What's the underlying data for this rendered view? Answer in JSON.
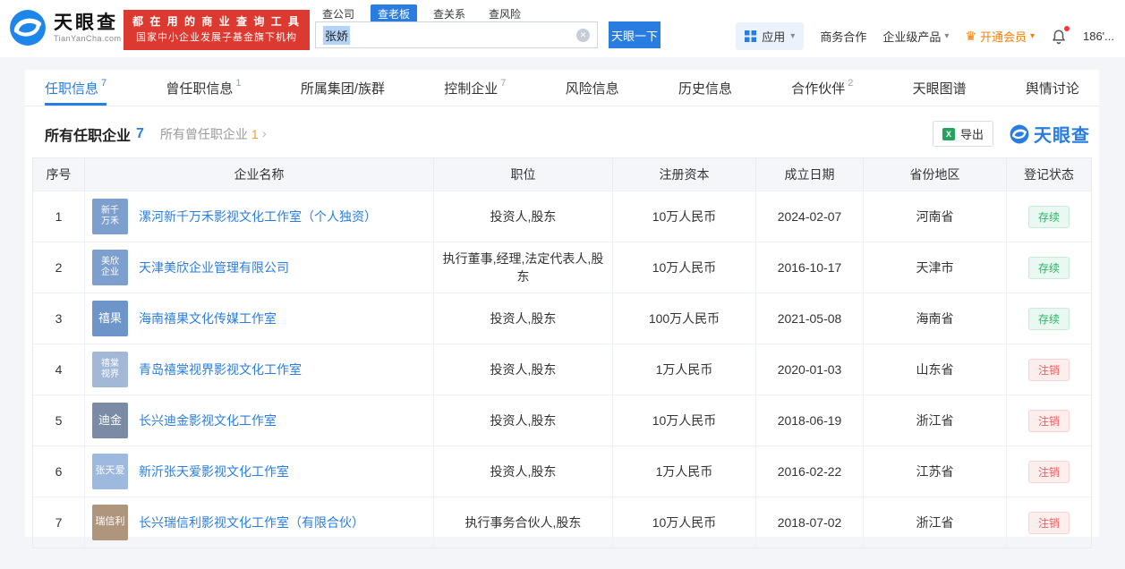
{
  "colors": {
    "accent": "#2a7de0",
    "vip_orange": "#ff7d00",
    "promo_red": "#dc3a31",
    "status_active_green": "#2bb36b",
    "status_cancelled_red": "#f25b5b"
  },
  "icons": {
    "chevron_down": "▾",
    "chevron_right": "›",
    "close_circle": "✕",
    "crown": "♛",
    "excel_mark": "X"
  },
  "header": {
    "logo_text": "天眼查",
    "logo_sub": "TianYanCha.com",
    "badge_line1": "都 在 用 的 商 业 查 询 工 具",
    "badge_line2": "国家中小企业发展子基金旗下机构",
    "search_tabs": [
      {
        "label": "查公司",
        "active": false
      },
      {
        "label": "查老板",
        "active": true
      },
      {
        "label": "查关系",
        "active": false
      },
      {
        "label": "查风险",
        "active": false
      }
    ],
    "search_value": "张娇",
    "search_button": "天眼一下",
    "apps": "应用",
    "coop": "商务合作",
    "enterprise": "企业级产品",
    "vip": "开通会员",
    "account": "186'..."
  },
  "nav_tabs": [
    {
      "label": "任职信息",
      "count": "7",
      "active": true
    },
    {
      "label": "曾任职信息",
      "count": "1",
      "active": false
    },
    {
      "label": "所属集团/族群",
      "count": "",
      "active": false
    },
    {
      "label": "控制企业",
      "count": "7",
      "active": false
    },
    {
      "label": "风险信息",
      "count": "",
      "active": false
    },
    {
      "label": "历史信息",
      "count": "",
      "active": false
    },
    {
      "label": "合作伙伴",
      "count": "2",
      "active": false
    },
    {
      "label": "天眼图谱",
      "count": "",
      "active": false
    },
    {
      "label": "舆情讨论",
      "count": "",
      "active": false
    }
  ],
  "section": {
    "title": "所有任职企业",
    "title_count": "7",
    "secondary": "所有曾任职企业",
    "secondary_count": "1",
    "export_label": "导出",
    "watermark": "天眼查"
  },
  "table": {
    "columns": [
      "序号",
      "企业名称",
      "职位",
      "注册资本",
      "成立日期",
      "省份地区",
      "登记状态"
    ],
    "rows": [
      {
        "no": "1",
        "icon_lines": [
          "新千",
          "万禾"
        ],
        "icon_color": "#7d9fce",
        "name": "漯河新千万禾影视文化工作室（个人独资）",
        "position": "投资人,股东",
        "capital": "10万人民币",
        "date": "2024-02-07",
        "region": "河南省",
        "status": "存续",
        "status_type": "active"
      },
      {
        "no": "2",
        "icon_lines": [
          "美欣",
          "企业"
        ],
        "icon_color": "#7d9fce",
        "name": "天津美欣企业管理有限公司",
        "position": "执行董事,经理,法定代表人,股东",
        "capital": "10万人民币",
        "date": "2016-10-17",
        "region": "天津市",
        "status": "存续",
        "status_type": "active"
      },
      {
        "no": "3",
        "icon_lines": [
          "禧果"
        ],
        "icon_color": "#6d95c9",
        "name": "海南禧果文化传媒工作室",
        "position": "投资人,股东",
        "capital": "100万人民币",
        "date": "2021-05-08",
        "region": "海南省",
        "status": "存续",
        "status_type": "active"
      },
      {
        "no": "4",
        "icon_lines": [
          "禧棠",
          "视界"
        ],
        "icon_color": "#a3b8d6",
        "name": "青岛禧棠视界影视文化工作室",
        "position": "投资人,股东",
        "capital": "1万人民币",
        "date": "2020-01-03",
        "region": "山东省",
        "status": "注销",
        "status_type": "cancelled"
      },
      {
        "no": "5",
        "icon_lines": [
          "迪金"
        ],
        "icon_color": "#7b8aa5",
        "name": "长兴迪金影视文化工作室",
        "position": "投资人,股东",
        "capital": "10万人民币",
        "date": "2018-06-19",
        "region": "浙江省",
        "status": "注销",
        "status_type": "cancelled"
      },
      {
        "no": "6",
        "icon_lines": [
          "张天爱"
        ],
        "icon_color": "#9db9dd",
        "name": "新沂张天爱影视文化工作室",
        "position": "投资人,股东",
        "capital": "1万人民币",
        "date": "2016-02-22",
        "region": "江苏省",
        "status": "注销",
        "status_type": "cancelled"
      },
      {
        "no": "7",
        "icon_lines": [
          "瑞信利"
        ],
        "icon_color": "#b0957d",
        "name": "长兴瑞信利影视文化工作室（有限合伙）",
        "position": "执行事务合伙人,股东",
        "capital": "10万人民币",
        "date": "2018-07-02",
        "region": "浙江省",
        "status": "注销",
        "status_type": "cancelled"
      }
    ]
  }
}
